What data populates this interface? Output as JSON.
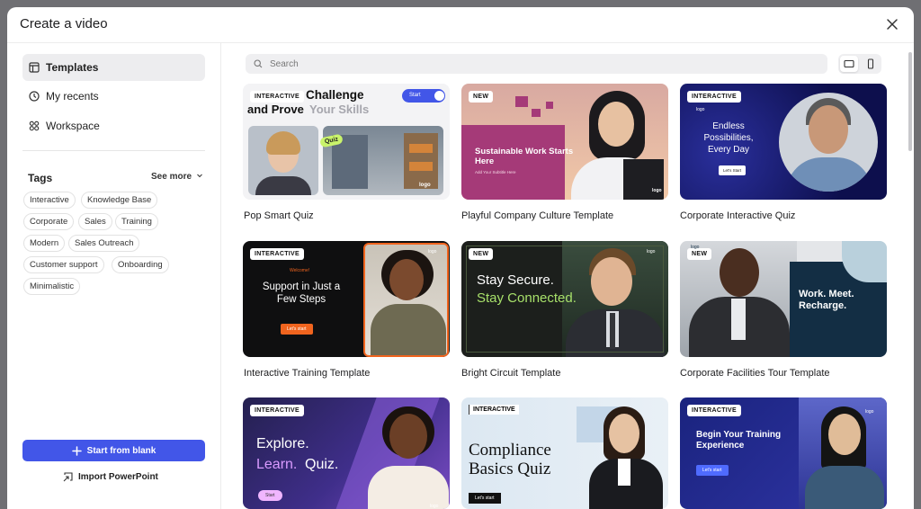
{
  "window": {
    "title": "Create a video"
  },
  "sidebar": {
    "items": [
      {
        "label": "Templates",
        "icon": "templates-icon",
        "active": true
      },
      {
        "label": "My recents",
        "icon": "clock-icon",
        "active": false
      },
      {
        "label": "Workspace",
        "icon": "workspace-icon",
        "active": false
      }
    ],
    "tags_title": "Tags",
    "see_more": "See more",
    "tags": [
      "Interactive",
      "Knowledge Base",
      "Corporate",
      "Sales",
      "Training",
      "Modern",
      "Sales Outreach",
      "Customer support",
      "Onboarding",
      "Minimalistic"
    ],
    "start_button": "Start from blank",
    "import_button": "Import PowerPoint"
  },
  "search": {
    "placeholder": "Search"
  },
  "colors": {
    "accent": "#4256e8",
    "interactive_badge": "#ffffff"
  },
  "templates": [
    {
      "label": "Pop Smart Quiz",
      "badge": "INTERACTIVE",
      "headline_a": "Challenge",
      "headline_b": "and Prove",
      "headline_c": "Your Skills",
      "cta": "Start",
      "sticker": "Quiz",
      "logo": "logo"
    },
    {
      "label": "Playful Company Culture Template",
      "badge": "NEW",
      "headline": "Sustainable Work Starts Here",
      "sub": "Add Your Subtitle Here",
      "logo": "logo"
    },
    {
      "label": "Corporate Interactive Quiz",
      "badge": "INTERACTIVE",
      "headline": "Endless Possibilities, Every Day",
      "cta": "Let's Start",
      "logo": "logo"
    },
    {
      "label": "Interactive Training Template",
      "badge": "INTERACTIVE",
      "kicker": "Welcome!",
      "headline": "Support in Just a Few Steps",
      "cta": "Let's start",
      "logo": "logo"
    },
    {
      "label": "Bright Circuit Template",
      "badge": "NEW",
      "headline_a": "Stay Secure.",
      "headline_b": "Stay Connected.",
      "logo": "logo"
    },
    {
      "label": "Corporate Facilities Tour Template",
      "badge": "NEW",
      "headline": "Work. Meet. Recharge.",
      "logo": "logo"
    },
    {
      "label": "",
      "badge": "INTERACTIVE",
      "headline_a": "Explore.",
      "headline_b": "Learn.",
      "headline_c": "Quiz.",
      "cta": "Start",
      "logo": "logo"
    },
    {
      "label": "",
      "badge": "INTERACTIVE",
      "headline": "Compliance Basics Quiz",
      "cta": "Let's start"
    },
    {
      "label": "",
      "badge": "INTERACTIVE",
      "headline": "Begin Your Training Experience",
      "cta": "Let's start",
      "logo": "logo"
    }
  ]
}
